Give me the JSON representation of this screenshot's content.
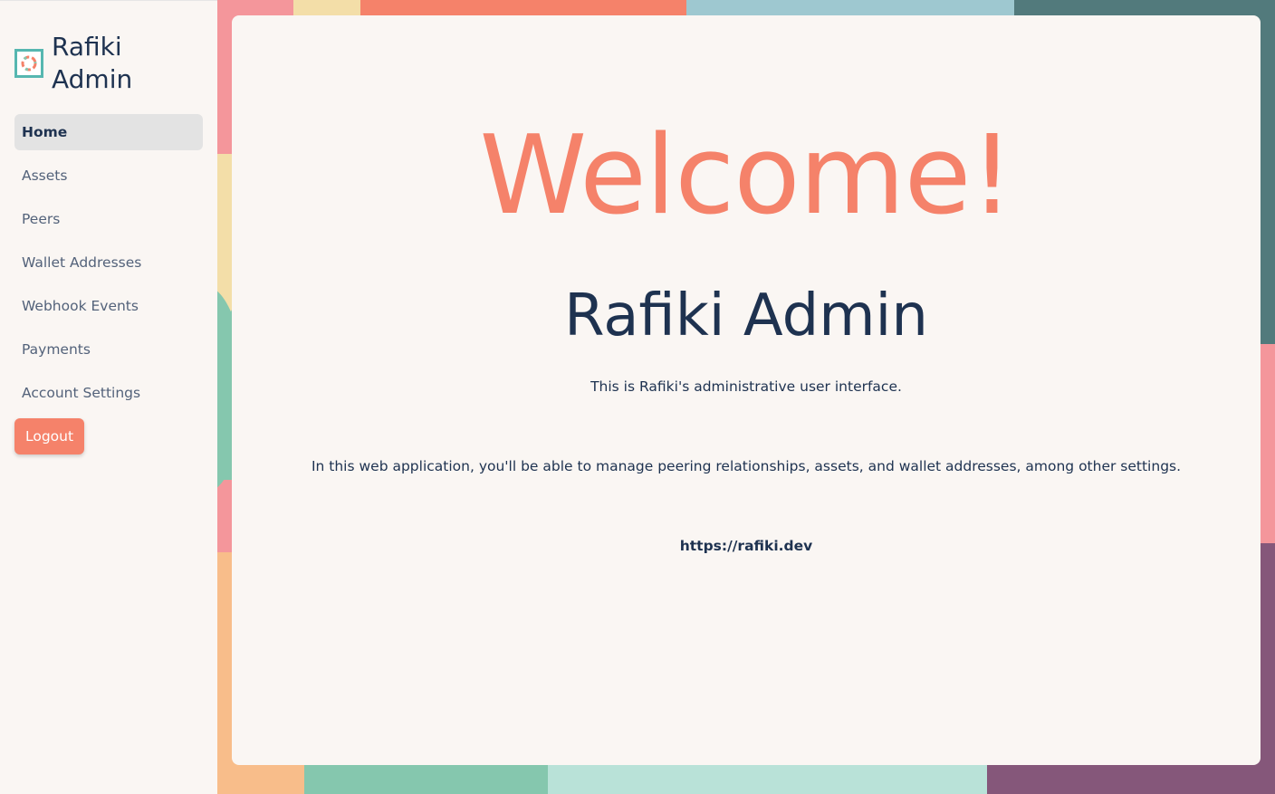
{
  "brand": {
    "title": "Rafiki\nAdmin",
    "logo_icon": "rafiki-logo-icon",
    "logo_border_color": "#56b7b0"
  },
  "nav": {
    "items": [
      {
        "label": "Home",
        "active": true
      },
      {
        "label": "Assets"
      },
      {
        "label": "Peers"
      },
      {
        "label": "Wallet Addresses"
      },
      {
        "label": "Webhook Events"
      },
      {
        "label": "Payments"
      },
      {
        "label": "Account Settings"
      }
    ],
    "logout_label": "Logout"
  },
  "main": {
    "welcome": "Welcome!",
    "title": "Rafiki Admin",
    "intro": "This is Rafiki's administrative user interface.",
    "description": "In this web application, you'll be able to manage peering relationships, assets, and wallet addresses, among other settings.",
    "link": "https://rafiki.dev"
  },
  "colors": {
    "accent": "#f5826a",
    "text_dark": "#1e3250",
    "text_muted": "#53627a",
    "background": "#faf6f3",
    "active_nav_bg": "#e3e3e3",
    "teal": "#56b7b0"
  }
}
